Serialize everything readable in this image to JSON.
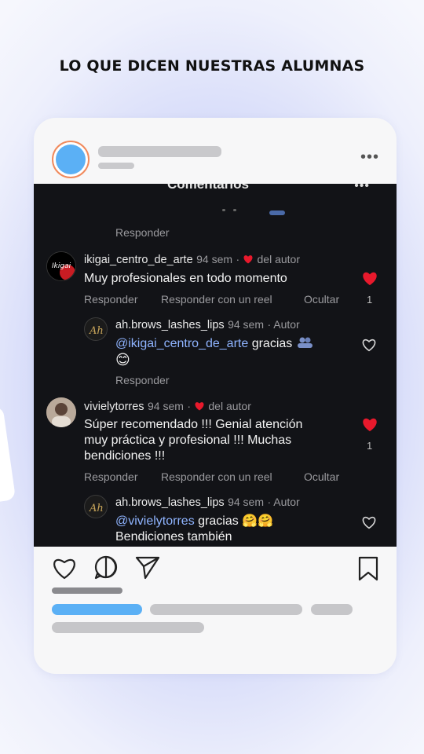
{
  "page": {
    "title": "LO QUE DICEN NUESTRAS ALUMNAS"
  },
  "colors": {
    "accent_blue": "#5bb0f5",
    "ring_orange": "#f08a5d",
    "heart_red": "#e8192c",
    "mention_blue": "#8fb4ff"
  },
  "post": {
    "more_icon": "more-horizontal-icon",
    "icons": [
      "heart-icon",
      "comment-icon",
      "share-icon",
      "bookmark-icon"
    ]
  },
  "screenshot": {
    "header_title": "Comentarios",
    "top_reply": "Responder",
    "comments": [
      {
        "user": "ikigai_centro_de_arte",
        "time": "94 sem",
        "author_badge": "del autor",
        "text": "Muy profesionales en todo momento",
        "likes": "1",
        "actions": [
          "Responder",
          "Responder con un reel",
          "Ocultar"
        ],
        "reply": {
          "user": "ah.brows_lashes_lips",
          "time": "94 sem",
          "badge": "Autor",
          "mention": "@ikigai_centro_de_arte",
          "text": "gracias",
          "emoji_line": "😊",
          "action": "Responder"
        }
      },
      {
        "user": "vivielytorres",
        "time": "94 sem",
        "author_badge": "del autor",
        "text_lines": [
          "Súper recomendado !!! Genial atención",
          "muy práctica y profesional !!! Muchas",
          "bendiciones !!!"
        ],
        "likes": "1",
        "actions": [
          "Responder",
          "Responder con un reel",
          "Ocultar"
        ],
        "reply": {
          "user": "ah.brows_lashes_lips",
          "time": "94 sem",
          "badge": "Autor",
          "mention": "@vivielytorres",
          "text": "gracias 🤗🤗",
          "line2": "Bendiciones también"
        }
      }
    ]
  }
}
